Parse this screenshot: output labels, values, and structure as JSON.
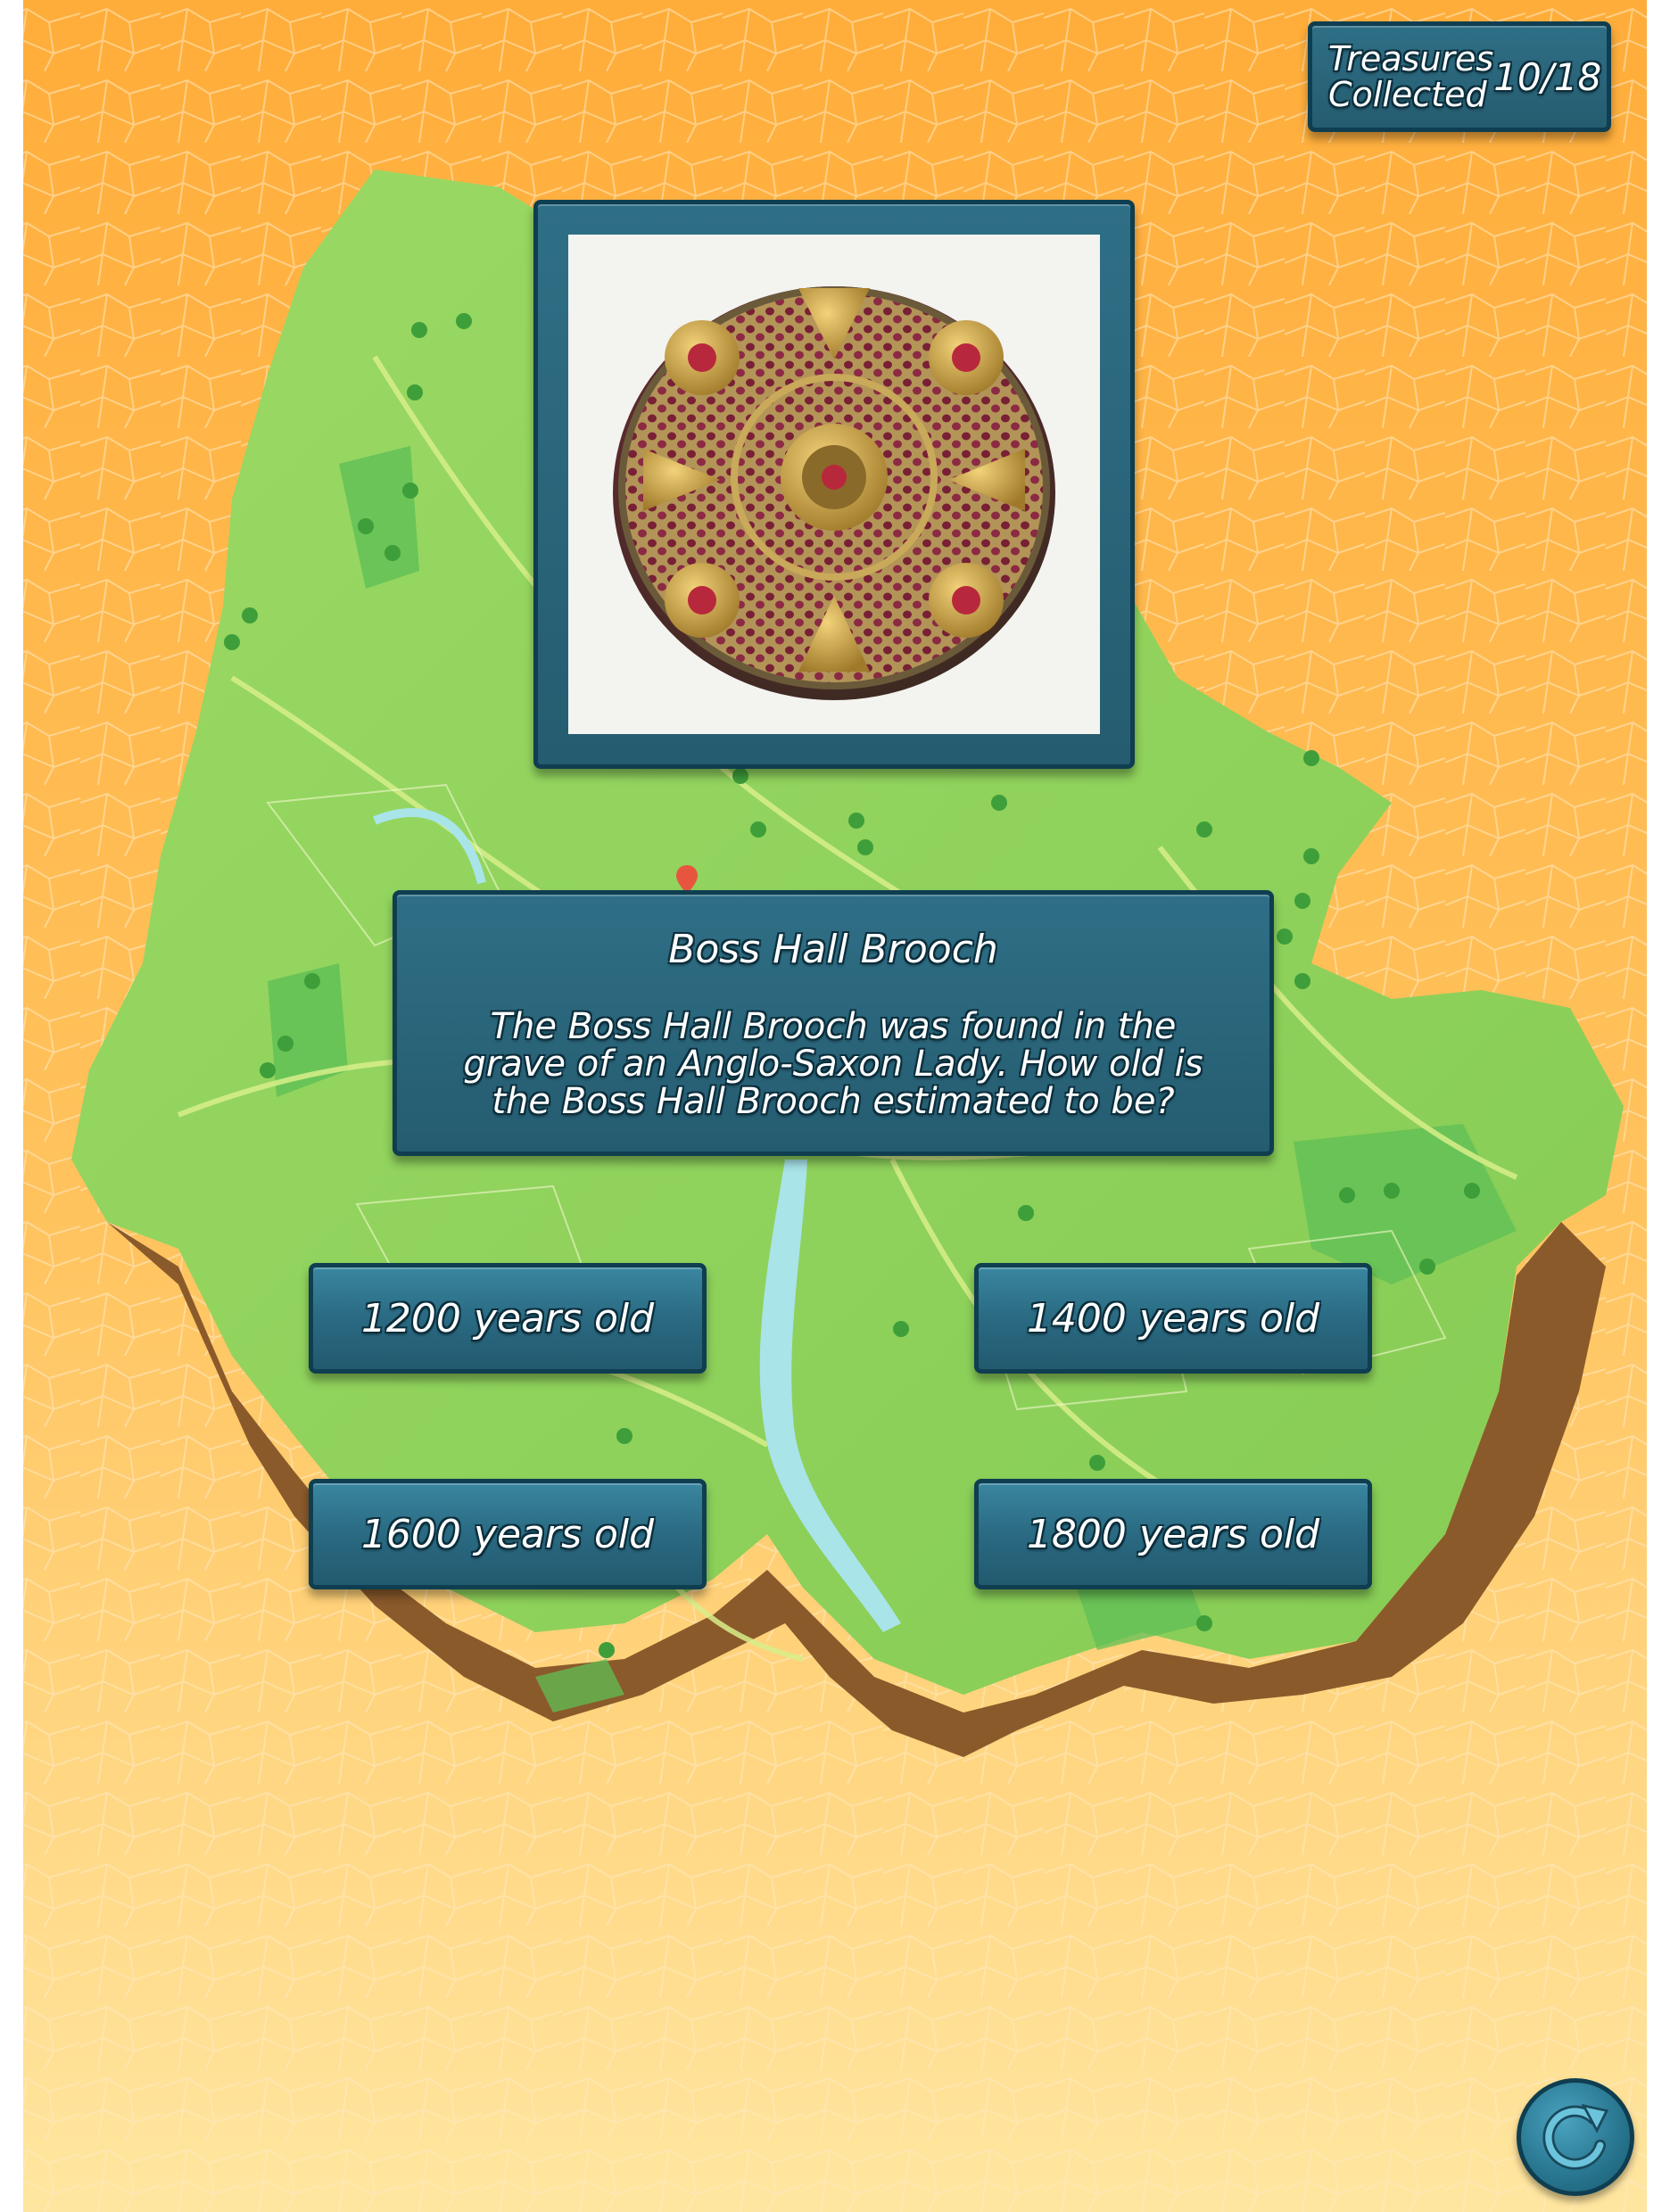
{
  "hud": {
    "score_label": "Treasures Collected",
    "score_value": "10/18"
  },
  "artifact_image": {
    "subject": "Boss Hall Brooch"
  },
  "question": {
    "title": "Boss Hall Brooch",
    "text": "The Boss Hall Brooch was found in the grave of an Anglo-Saxon Lady. How old is the Boss Hall Brooch estimated to be?"
  },
  "answers": [
    {
      "label": "1200 years old"
    },
    {
      "label": "1400 years old"
    },
    {
      "label": "1600 years old"
    },
    {
      "label": "1800 years old"
    }
  ],
  "controls": {
    "restart_icon": "restart-icon"
  },
  "colors": {
    "background_top": "#ffb040",
    "background_bottom": "#ffe49a",
    "map_land": "#8fd45a",
    "map_edge": "#8a5a2b",
    "river": "#a8e4e8",
    "panel": "#2a6a82",
    "panel_border": "#0f3e50",
    "text": "#ffffff"
  }
}
